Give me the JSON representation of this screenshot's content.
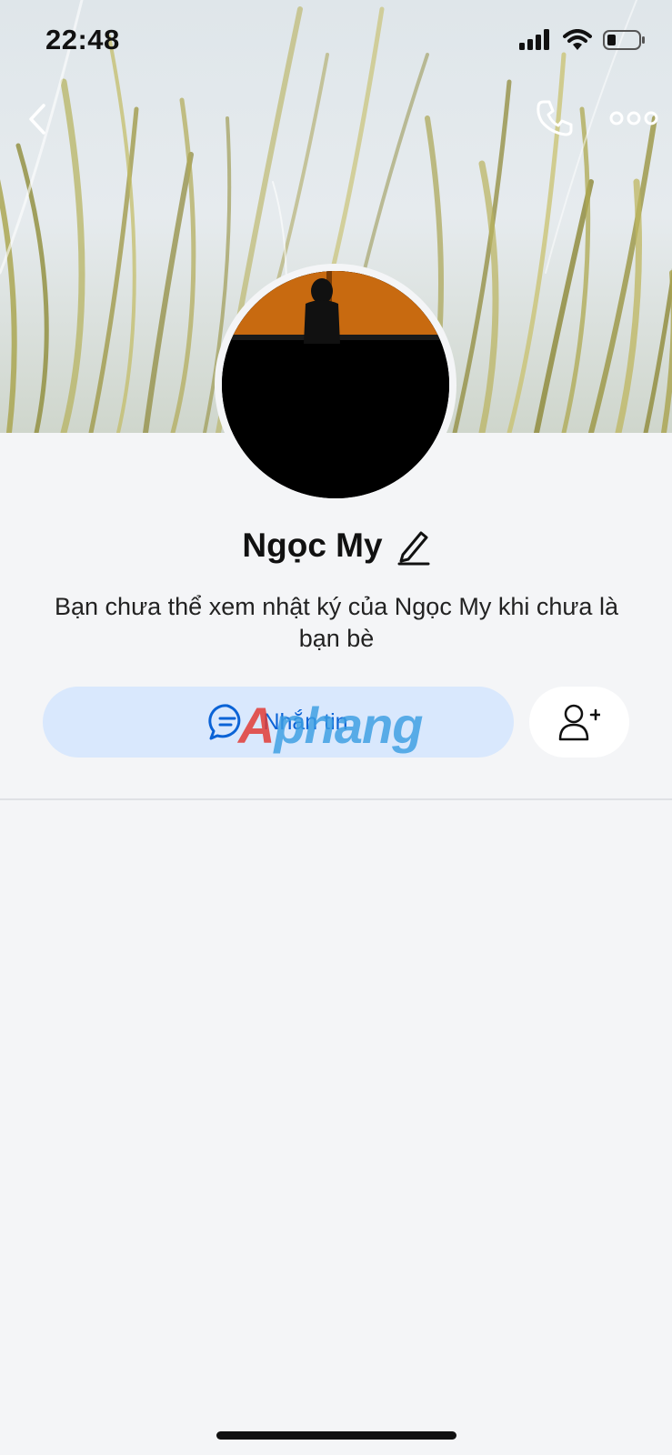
{
  "status_bar": {
    "time": "22:48",
    "icons": [
      "cellular-signal-icon",
      "wifi-icon",
      "battery-icon"
    ]
  },
  "nav": {
    "back_icon": "chevron-left-icon",
    "call_icon": "phone-icon",
    "more_icon": "more-horizontal-icon"
  },
  "profile": {
    "name": "Ngọc My",
    "edit_icon": "pencil-icon",
    "notice": "Bạn chưa thể xem nhật ký của Ngọc My khi chưa là bạn bè"
  },
  "actions": {
    "message_label": "Nhắn tin",
    "message_icon": "chat-bubble-icon",
    "add_friend_icon": "add-user-icon"
  },
  "watermark": {
    "first_letter": "A",
    "rest": "phang"
  },
  "colors": {
    "accent": "#0b63d6",
    "message_button_bg": "#d9e8fd",
    "page_bg": "#f4f5f7"
  }
}
